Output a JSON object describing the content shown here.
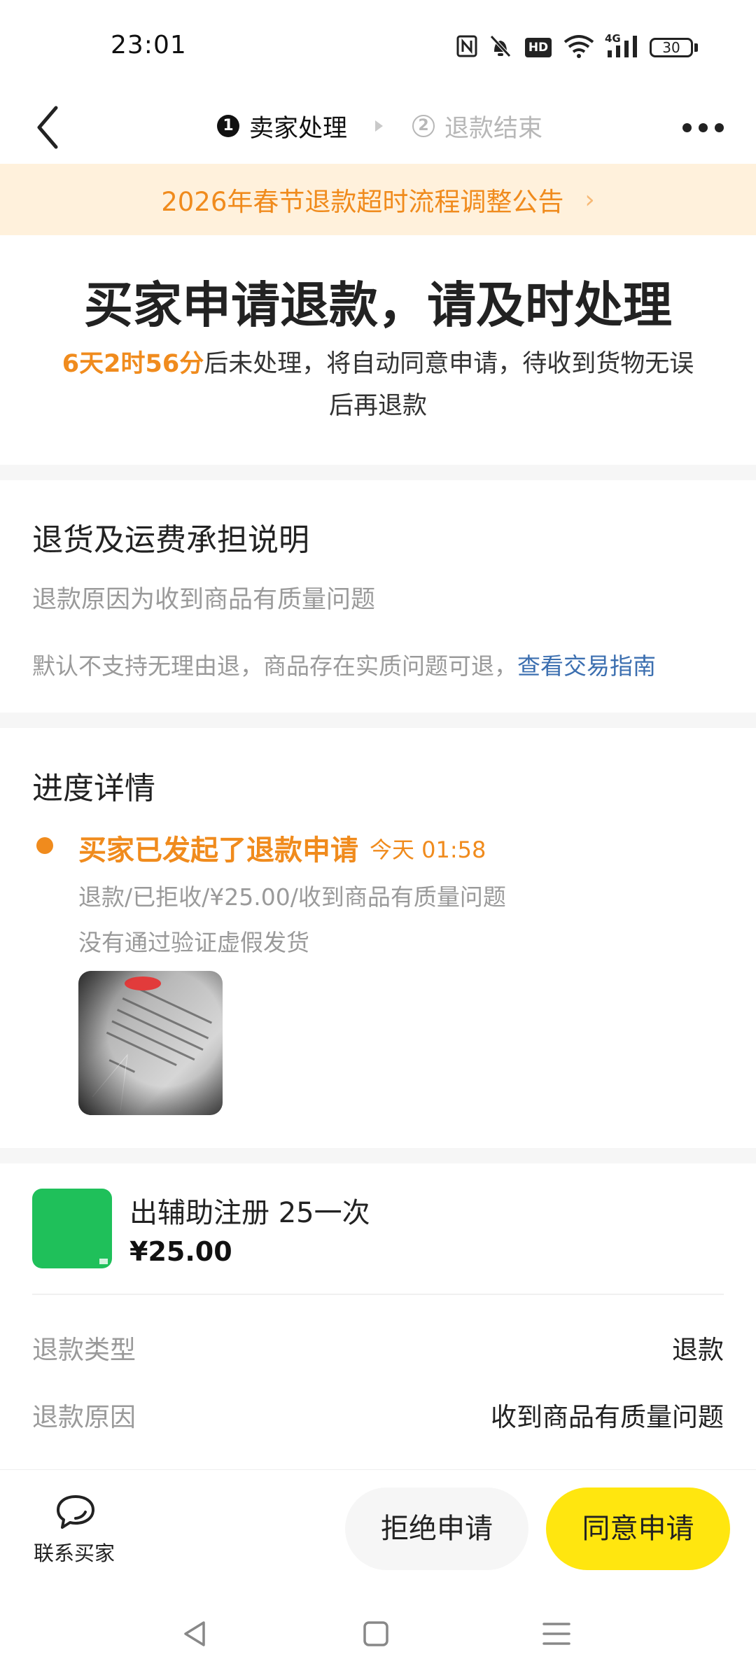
{
  "status_bar": {
    "time": "23:01",
    "hd_badge": "HD",
    "network": "4G",
    "battery": "30",
    "icons": [
      "nfc-icon",
      "silent-bell-icon",
      "hd-voice-icon",
      "wifi-icon",
      "signal-icon",
      "battery-icon"
    ]
  },
  "header": {
    "step1_num": "1",
    "step1_label": "卖家处理",
    "step2_num": "2",
    "step2_label": "退款结束"
  },
  "banner": {
    "text": "2026年春节退款超时流程调整公告",
    "chevron": "›"
  },
  "status": {
    "headline": "买家申请退款，请及时处理",
    "countdown": "6天2时56分",
    "message": "后未处理，将自动同意申请，待收到货物无误后再退款"
  },
  "policy": {
    "title": "退货及运费承担说明",
    "reason": "退款原因为收到商品有质量问题",
    "note": "默认不支持无理由退，商品存在实质问题可退，",
    "link": "查看交易指南"
  },
  "progress": {
    "title": "进度详情",
    "event": "买家已发起了退款申请",
    "time": "今天 01:58",
    "detail": "退款/已拒收/¥25.00/收到商品有质量问题",
    "note": "没有通过验证虚假发货"
  },
  "product": {
    "title": "出辅助注册 25一次",
    "price": "¥25.00"
  },
  "refund_info": [
    {
      "label": "退款类型",
      "value": "退款"
    },
    {
      "label": "退款原因",
      "value": "收到商品有质量问题"
    }
  ],
  "bottom": {
    "contact_label": "联系买家",
    "reject_label": "拒绝申请",
    "agree_label": "同意申请"
  },
  "colors": {
    "accent_orange": "#f08b1d",
    "banner_bg": "#fff1dc",
    "primary_yellow": "#ffe60f",
    "link_blue": "#3c6fb0",
    "product_green": "#1fc05a"
  }
}
